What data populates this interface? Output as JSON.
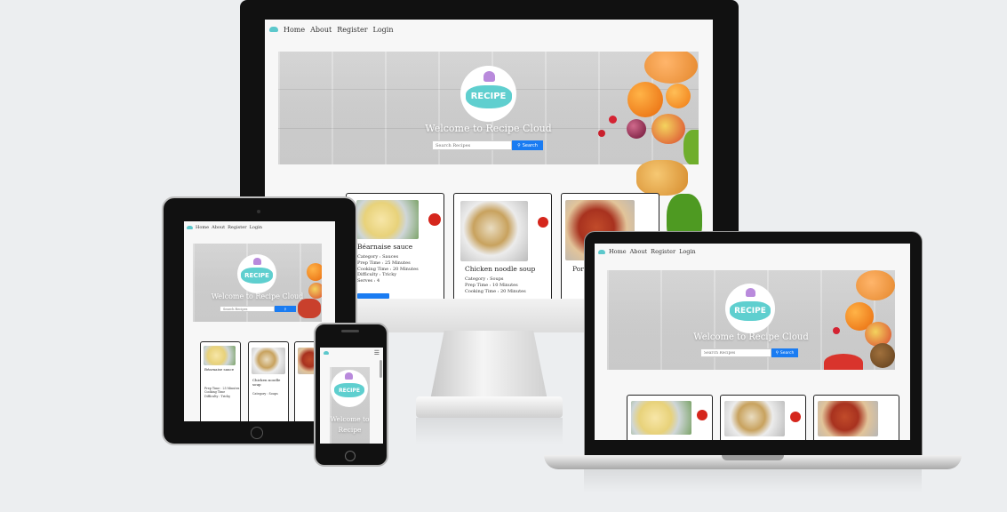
{
  "nav": {
    "items": [
      "Home",
      "About",
      "Register",
      "Login"
    ]
  },
  "hero": {
    "logo_text": "RECIPE",
    "welcome": "Welcome to Recipe Cloud",
    "search_placeholder": "Search Recipes",
    "search_button": "Search"
  },
  "cards": [
    {
      "title": "Béarnaise sauce",
      "meta": [
        {
          "label": "Category",
          "value": "Sauces"
        },
        {
          "label": "Prep Time",
          "value": "25 Minutes"
        },
        {
          "label": "Cooking Time",
          "value": "20 Minutes"
        },
        {
          "label": "Difficulty",
          "value": "Tricky"
        },
        {
          "label": "Serves",
          "value": "4"
        }
      ]
    },
    {
      "title": "Chicken noodle soup",
      "meta": [
        {
          "label": "Category",
          "value": "Soups"
        },
        {
          "label": "Prep Time",
          "value": "10 Minutes"
        },
        {
          "label": "Cooking Time",
          "value": "20 Minutes"
        }
      ]
    },
    {
      "title": "Pork",
      "meta": []
    }
  ],
  "phone": {
    "welcome_line1": "Welcome to",
    "welcome_line2": "Recipe"
  },
  "colors": {
    "accent": "#1a7cf2",
    "cloud": "#5fcfcf",
    "hat": "#b98adc"
  }
}
